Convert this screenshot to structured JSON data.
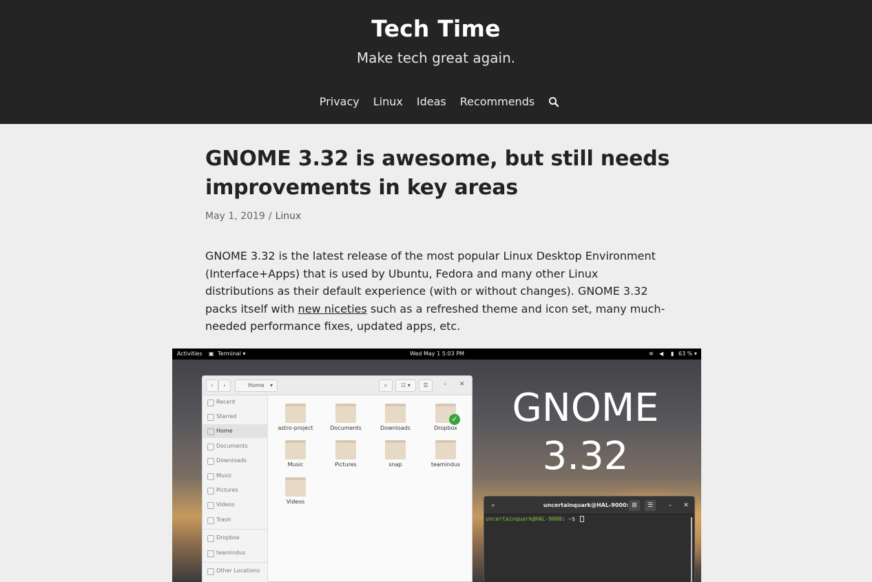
{
  "site": {
    "title": "Tech Time",
    "tagline": "Make tech great again."
  },
  "nav": {
    "items": [
      "Privacy",
      "Linux",
      "Ideas",
      "Recommends"
    ],
    "search_icon": "search-icon"
  },
  "post": {
    "title": "GNOME 3.32 is awesome, but still needs improvements in key areas",
    "date": "May 1, 2019",
    "separator": "/",
    "category": "Linux",
    "intro_before": "GNOME 3.32 is the latest release of the most popular Linux Desktop Environment (Interface+Apps) that is used by Ubuntu, Fedora and many other Linux distributions as their default experience (with or without changes). GNOME 3.32 packs itself with ",
    "intro_link": "new niceties",
    "intro_after": " such as a refreshed theme and icon set, many much-needed performance fixes, updated apps, etc."
  },
  "screenshot": {
    "topbar": {
      "activities": "Activities",
      "app": "Terminal ▾",
      "clock": "Wed May 1   5:03 PM",
      "battery": "63 % ▾"
    },
    "overlay_title": "GNOME",
    "overlay_version": "3.32",
    "files": {
      "path": "Home",
      "sidebar": [
        "Recent",
        "Starred",
        "Home",
        "Documents",
        "Downloads",
        "Music",
        "Pictures",
        "Videos",
        "Trash",
        "Dropbox",
        "teamindus",
        "Other Locations"
      ],
      "active_item": "Home",
      "folders": [
        "astro-project",
        "Documents",
        "Downloads",
        "Dropbox",
        "Music",
        "Pictures",
        "snap",
        "teamindus",
        "Videos"
      ]
    },
    "terminal": {
      "title": "uncertainquark@HAL-9000: ~",
      "prompt_user": "uncertainquark@HAL-9000",
      "prompt_rest": ": ~$ "
    }
  }
}
